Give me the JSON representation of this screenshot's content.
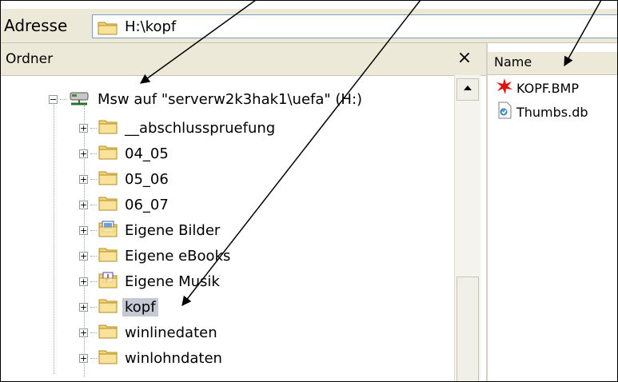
{
  "address": {
    "label": "Adresse",
    "value": "H:\\kopf"
  },
  "folders_pane": {
    "title": "Ordner",
    "close": "×"
  },
  "tree": {
    "drive": "Msw auf \"serverw2k3hak1\\uefa\" (H:)",
    "items": [
      {
        "label": "__abschlusspruefung",
        "icon": "folder-icon"
      },
      {
        "label": "04_05",
        "icon": "folder-icon"
      },
      {
        "label": "05_06",
        "icon": "folder-icon"
      },
      {
        "label": "06_07",
        "icon": "folder-icon"
      },
      {
        "label": "Eigene Bilder",
        "icon": "pictures-folder-icon"
      },
      {
        "label": "Eigene eBooks",
        "icon": "folder-icon"
      },
      {
        "label": "Eigene Musik",
        "icon": "music-folder-icon"
      },
      {
        "label": "kopf",
        "icon": "folder-icon",
        "selected": true
      },
      {
        "label": "winlinedaten",
        "icon": "folder-icon"
      },
      {
        "label": "winlohndaten",
        "icon": "folder-icon"
      }
    ]
  },
  "file_list": {
    "column": "Name",
    "files": [
      {
        "name": "KOPF.BMP",
        "icon": "bitmap-icon"
      },
      {
        "name": "Thumbs.db",
        "icon": "db-file-icon"
      }
    ]
  },
  "colors": {
    "toolbar": "#ece9d8",
    "selection": "#c4c9d4",
    "folder": "#f5d66b"
  }
}
